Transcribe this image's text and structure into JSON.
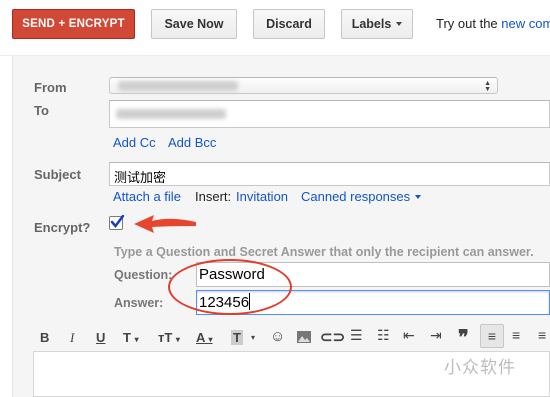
{
  "toolbar": {
    "send_label": "SEND + ENCRYPT",
    "save_label": "Save Now",
    "discard_label": "Discard",
    "labels_label": "Labels",
    "tryout_prefix": "Try out the",
    "tryout_link": "new com"
  },
  "compose": {
    "from_label": "From",
    "to_label": "To",
    "add_cc": "Add Cc",
    "add_bcc": "Add Bcc",
    "subject_label": "Subject",
    "subject_value": "测试加密",
    "attach_link": "Attach a file",
    "insert_label": "Insert:",
    "invitation_link": "Invitation",
    "canned_link": "Canned responses",
    "encrypt_label": "Encrypt?",
    "encrypt_checked": true,
    "encrypt_hint": "Type a Question and Secret Answer that only the recipient can answer.",
    "question_label": "Question:",
    "question_value": "Password",
    "answer_label": "Answer:",
    "answer_value": "123456"
  },
  "format_toolbar": {
    "icons": [
      "bold-icon",
      "italic-icon",
      "underline-icon",
      "font-icon",
      "font-size-icon",
      "text-color-icon",
      "highlight-icon",
      "emoji-icon",
      "image-icon",
      "link-icon",
      "numbered-list-icon",
      "bulleted-list-icon",
      "indent-less-icon",
      "indent-more-icon",
      "quote-icon",
      "align-left-icon",
      "align-center-icon",
      "align-right-icon"
    ]
  },
  "watermark": "小众软件",
  "colors": {
    "send_button": "#d14836",
    "link": "#1155cc",
    "annotation_red": "#e23c2c",
    "focus_border": "#4d90fe"
  }
}
